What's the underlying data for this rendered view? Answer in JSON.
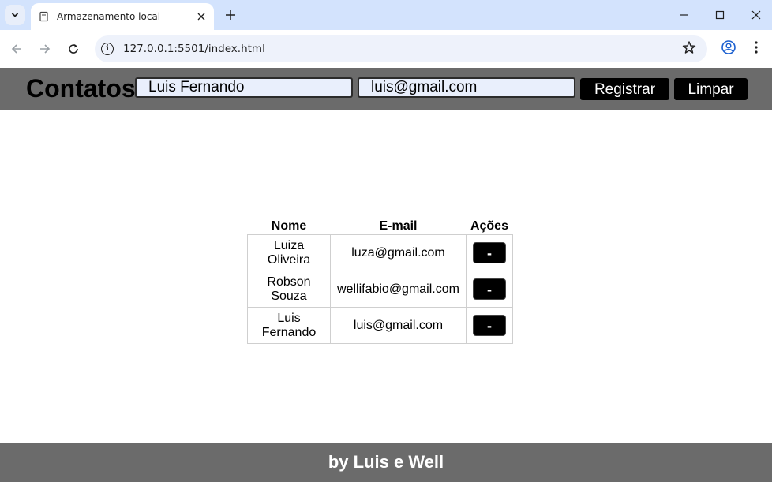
{
  "browser": {
    "tab_title": "Armazenamento local",
    "url": "127.0.0.1:5501/index.html"
  },
  "page": {
    "title": "Contatos",
    "form": {
      "name_value": "Luis Fernando",
      "email_value": "luis@gmail.com",
      "register_label": "Registrar",
      "clear_label": "Limpar"
    },
    "table": {
      "headers": [
        "Nome",
        "E-mail",
        "Ações"
      ],
      "rows": [
        {
          "name": "Luiza Oliveira",
          "email": "luza@gmail.com",
          "action": "-"
        },
        {
          "name": "Robson Souza",
          "email": "wellifabio@gmail.com",
          "action": "-"
        },
        {
          "name": "Luis Fernando",
          "email": "luis@gmail.com",
          "action": "-"
        }
      ]
    },
    "footer": "by Luis e Well"
  },
  "icons": {
    "tab_search": "chevron-down-icon",
    "favicon": "page-icon",
    "close": "close-icon",
    "new_tab": "plus-icon",
    "back": "arrow-left-icon",
    "forward": "arrow-right-icon",
    "reload": "reload-icon",
    "info": "info-icon",
    "bookmark": "star-icon",
    "profile": "profile-icon",
    "menu": "kebab-menu-icon"
  }
}
